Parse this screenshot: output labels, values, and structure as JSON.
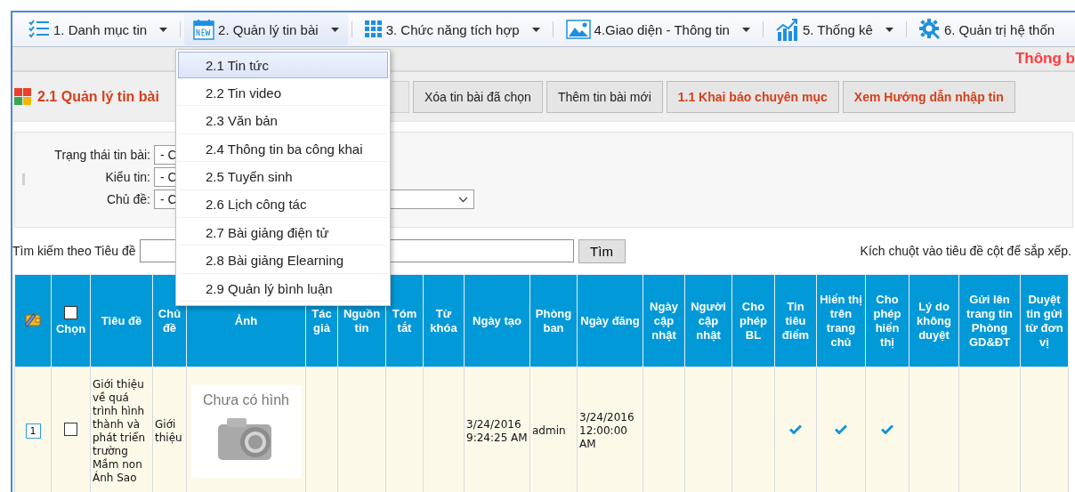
{
  "menu": [
    {
      "label": "1. Danh mục tin",
      "caret": true,
      "selected": false
    },
    {
      "label": "2. Quản lý tin bài",
      "caret": true,
      "selected": true
    },
    {
      "label": "3. Chức năng tích hợp",
      "caret": true,
      "selected": false
    },
    {
      "label": "4.Giao diện - Thông tin",
      "caret": true,
      "selected": false
    },
    {
      "label": "5. Thống kê",
      "caret": true,
      "selected": false
    },
    {
      "label": "6. Quản trị hệ thốn",
      "caret": false,
      "selected": false
    }
  ],
  "dropdown": [
    {
      "label": "2.1 Tin tức",
      "selected": true
    },
    {
      "label": "2.2 Tin video",
      "selected": false
    },
    {
      "label": "2.3 Văn bản",
      "selected": false
    },
    {
      "label": "2.4 Thông tin ba công khai",
      "selected": false
    },
    {
      "label": "2.5 Tuyển sinh",
      "selected": false
    },
    {
      "label": "2.6 Lịch công tác",
      "selected": false
    },
    {
      "label": "2.7 Bài giảng điện tử",
      "selected": false
    },
    {
      "label": "2.8 Bài giảng Elearning",
      "selected": false
    },
    {
      "label": "2.9 Quản lý bình luận",
      "selected": false
    }
  ],
  "notice": "Thông b",
  "toolbar": {
    "title": "2.1 Quản lý tin bài",
    "buttons": [
      {
        "kind": "disabled"
      },
      {
        "label": "Xóa tin bài đã chọn",
        "kind": "normal"
      },
      {
        "label": "Thêm tin bài mới",
        "kind": "normal"
      },
      {
        "label": "1.1  Khai báo chuyên mục",
        "kind": "highlight"
      },
      {
        "label": "Xem Hướng dẫn nhập tin",
        "kind": "highlight"
      }
    ]
  },
  "filters": [
    {
      "label": "Trạng thái tin bài:",
      "value": "- C",
      "wide": false
    },
    {
      "label": "Kiểu tin:",
      "value": "- C",
      "wide": false
    },
    {
      "label": "Chủ đề:",
      "value": "- C",
      "wide": true
    }
  ],
  "search": {
    "label": "Tìm kiếm theo Tiêu đề",
    "button": "Tìm",
    "hint": "Kích chuột vào tiêu đề cột để sắp xếp."
  },
  "table": {
    "columns": [
      {
        "kind": "icon"
      },
      {
        "kind": "checkbox",
        "label": "Chọn",
        "checked": false
      },
      {
        "kind": "text",
        "label": "Tiêu đề"
      },
      {
        "kind": "text",
        "label": "Chủ đề"
      },
      {
        "kind": "text",
        "label": "Ảnh"
      },
      {
        "kind": "text",
        "label": "Tác giả"
      },
      {
        "kind": "text",
        "label": "Nguồn tin"
      },
      {
        "kind": "text",
        "label": "Tóm tắt"
      },
      {
        "kind": "text",
        "label": "Từ khóa"
      },
      {
        "kind": "text",
        "label": "Ngày tạo"
      },
      {
        "kind": "text",
        "label": "Phòng ban"
      },
      {
        "kind": "text",
        "label": "Ngày đăng"
      },
      {
        "kind": "text",
        "label": "Ngày cập nhật"
      },
      {
        "kind": "text",
        "label": "Người cập nhật"
      },
      {
        "kind": "text",
        "label": "Cho phép BL"
      },
      {
        "kind": "text",
        "label": "Tin tiêu điểm"
      },
      {
        "kind": "text",
        "label": "Hiển thị trên trang chủ"
      },
      {
        "kind": "text",
        "label": "Cho phép hiển thị"
      },
      {
        "kind": "text",
        "label": "Lý do không duyệt"
      },
      {
        "kind": "text",
        "label": "Gửi lên trang tin Phòng GD&ĐT"
      },
      {
        "kind": "text",
        "label": "Duyệt tin gửi từ đơn vị"
      }
    ],
    "rows": [
      {
        "cells": [
          {
            "kind": "index",
            "text": "1"
          },
          {
            "kind": "checkbox",
            "checked": false
          },
          {
            "kind": "text",
            "text": "Giới thiệu về quá trình hình thành và phát triển trường Mầm non Ánh Sao"
          },
          {
            "kind": "text",
            "text": "Giới thiệu"
          },
          {
            "kind": "image",
            "caption": "Chưa có hình"
          },
          {
            "kind": "empty"
          },
          {
            "kind": "empty"
          },
          {
            "kind": "empty"
          },
          {
            "kind": "empty"
          },
          {
            "kind": "text",
            "text": "3/24/2016 9:24:25 AM"
          },
          {
            "kind": "text",
            "text": "admin"
          },
          {
            "kind": "text",
            "text": "3/24/2016 12:00:00 AM"
          },
          {
            "kind": "empty"
          },
          {
            "kind": "empty"
          },
          {
            "kind": "check",
            "checked": false
          },
          {
            "kind": "check",
            "checked": true
          },
          {
            "kind": "check",
            "checked": true
          },
          {
            "kind": "check",
            "checked": true
          },
          {
            "kind": "empty"
          },
          {
            "kind": "empty"
          },
          {
            "kind": "empty"
          }
        ]
      }
    ]
  }
}
